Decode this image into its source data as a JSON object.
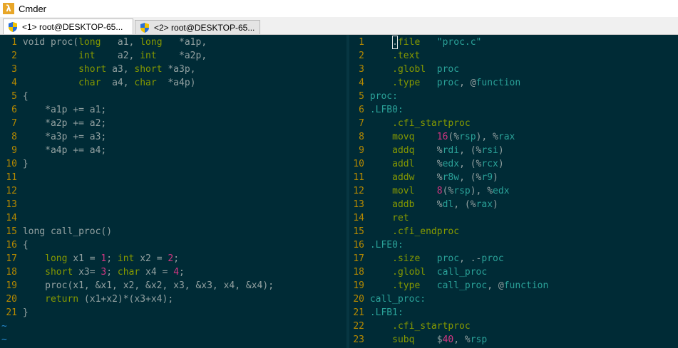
{
  "window": {
    "app_icon_glyph": "λ",
    "title": "Cmder",
    "icon": "cmder-lambda-icon"
  },
  "tabs": [
    {
      "label": "<1> root@DESKTOP-65...",
      "active": true,
      "icon": "uac-shield-icon"
    },
    {
      "label": "<2> root@DESKTOP-65...",
      "active": false,
      "icon": "uac-shield-icon"
    }
  ],
  "left_pane": {
    "lines": [
      {
        "n": "1",
        "tokens": [
          [
            "plain",
            "void proc("
          ],
          [
            "type",
            "long"
          ],
          [
            "plain",
            "   a1, "
          ],
          [
            "type",
            "long"
          ],
          [
            "plain",
            "   *a1p,"
          ]
        ]
      },
      {
        "n": "2",
        "tokens": [
          [
            "plain",
            "          "
          ],
          [
            "type",
            "int"
          ],
          [
            "plain",
            "    a2, "
          ],
          [
            "type",
            "int"
          ],
          [
            "plain",
            "    *a2p,"
          ]
        ]
      },
      {
        "n": "3",
        "tokens": [
          [
            "plain",
            "          "
          ],
          [
            "type",
            "short"
          ],
          [
            "plain",
            " a3, "
          ],
          [
            "type",
            "short"
          ],
          [
            "plain",
            " *a3p,"
          ]
        ]
      },
      {
        "n": "4",
        "tokens": [
          [
            "plain",
            "          "
          ],
          [
            "type",
            "char"
          ],
          [
            "plain",
            "  a4, "
          ],
          [
            "type",
            "char"
          ],
          [
            "plain",
            "  *a4p)"
          ]
        ]
      },
      {
        "n": "5",
        "tokens": [
          [
            "plain",
            "{"
          ]
        ]
      },
      {
        "n": "6",
        "tokens": [
          [
            "plain",
            "    *a1p += a1;"
          ]
        ]
      },
      {
        "n": "7",
        "tokens": [
          [
            "plain",
            "    *a2p += a2;"
          ]
        ]
      },
      {
        "n": "8",
        "tokens": [
          [
            "plain",
            "    *a3p += a3;"
          ]
        ]
      },
      {
        "n": "9",
        "tokens": [
          [
            "plain",
            "    *a4p += a4;"
          ]
        ]
      },
      {
        "n": "10",
        "tokens": [
          [
            "plain",
            "}"
          ]
        ]
      },
      {
        "n": "11",
        "tokens": []
      },
      {
        "n": "12",
        "tokens": []
      },
      {
        "n": "13",
        "tokens": []
      },
      {
        "n": "14",
        "tokens": []
      },
      {
        "n": "15",
        "tokens": [
          [
            "plain",
            "long call_proc()"
          ]
        ]
      },
      {
        "n": "16",
        "tokens": [
          [
            "plain",
            "{"
          ]
        ]
      },
      {
        "n": "17",
        "tokens": [
          [
            "plain",
            "    "
          ],
          [
            "type",
            "long"
          ],
          [
            "plain",
            " x1 = "
          ],
          [
            "num",
            "1"
          ],
          [
            "plain",
            "; "
          ],
          [
            "type",
            "int"
          ],
          [
            "plain",
            " x2 = "
          ],
          [
            "num",
            "2"
          ],
          [
            "plain",
            ";"
          ]
        ]
      },
      {
        "n": "18",
        "tokens": [
          [
            "plain",
            "    "
          ],
          [
            "type",
            "short"
          ],
          [
            "plain",
            " x3= "
          ],
          [
            "num",
            "3"
          ],
          [
            "plain",
            "; "
          ],
          [
            "type",
            "char"
          ],
          [
            "plain",
            " x4 = "
          ],
          [
            "num",
            "4"
          ],
          [
            "plain",
            ";"
          ]
        ]
      },
      {
        "n": "19",
        "tokens": [
          [
            "plain",
            "    proc(x1, &x1, x2, &x2, x3, &x3, x4, &x4);"
          ]
        ]
      },
      {
        "n": "20",
        "tokens": [
          [
            "plain",
            "    "
          ],
          [
            "kw",
            "return"
          ],
          [
            "plain",
            " (x1+x2)*(x3+x4);"
          ]
        ]
      },
      {
        "n": "21",
        "tokens": [
          [
            "plain",
            "}"
          ]
        ]
      }
    ],
    "tilde_lines": [
      "~",
      "~"
    ]
  },
  "right_pane": {
    "lines": [
      {
        "n": "1",
        "tokens": [
          [
            "plain",
            "    "
          ],
          [
            "cursor",
            "."
          ],
          [
            "dir",
            "file"
          ],
          [
            "plain",
            "   "
          ],
          [
            "str",
            "\"proc.c\""
          ]
        ]
      },
      {
        "n": "2",
        "tokens": [
          [
            "plain",
            "    "
          ],
          [
            "dir",
            ".text"
          ]
        ]
      },
      {
        "n": "3",
        "tokens": [
          [
            "plain",
            "    "
          ],
          [
            "dir",
            ".globl"
          ],
          [
            "plain",
            "  "
          ],
          [
            "ident",
            "proc"
          ]
        ]
      },
      {
        "n": "4",
        "tokens": [
          [
            "plain",
            "    "
          ],
          [
            "dir",
            ".type"
          ],
          [
            "plain",
            "   "
          ],
          [
            "ident",
            "proc"
          ],
          [
            "plain",
            ", @"
          ],
          [
            "ident",
            "function"
          ]
        ]
      },
      {
        "n": "5",
        "tokens": [
          [
            "label",
            "proc:"
          ]
        ]
      },
      {
        "n": "6",
        "tokens": [
          [
            "label",
            ".LFB0:"
          ]
        ]
      },
      {
        "n": "7",
        "tokens": [
          [
            "plain",
            "    "
          ],
          [
            "dir",
            ".cfi_startproc"
          ]
        ]
      },
      {
        "n": "8",
        "tokens": [
          [
            "plain",
            "    "
          ],
          [
            "dir",
            "movq"
          ],
          [
            "plain",
            "    "
          ],
          [
            "num",
            "16"
          ],
          [
            "plain",
            "(%"
          ],
          [
            "ident",
            "rsp"
          ],
          [
            "plain",
            "), %"
          ],
          [
            "ident",
            "rax"
          ]
        ]
      },
      {
        "n": "9",
        "tokens": [
          [
            "plain",
            "    "
          ],
          [
            "dir",
            "addq"
          ],
          [
            "plain",
            "    %"
          ],
          [
            "ident",
            "rdi"
          ],
          [
            "plain",
            ", (%"
          ],
          [
            "ident",
            "rsi"
          ],
          [
            "plain",
            ")"
          ]
        ]
      },
      {
        "n": "10",
        "tokens": [
          [
            "plain",
            "    "
          ],
          [
            "dir",
            "addl"
          ],
          [
            "plain",
            "    %"
          ],
          [
            "ident",
            "edx"
          ],
          [
            "plain",
            ", (%"
          ],
          [
            "ident",
            "rcx"
          ],
          [
            "plain",
            ")"
          ]
        ]
      },
      {
        "n": "11",
        "tokens": [
          [
            "plain",
            "    "
          ],
          [
            "dir",
            "addw"
          ],
          [
            "plain",
            "    %"
          ],
          [
            "ident",
            "r8w"
          ],
          [
            "plain",
            ", (%"
          ],
          [
            "ident",
            "r9"
          ],
          [
            "plain",
            ")"
          ]
        ]
      },
      {
        "n": "12",
        "tokens": [
          [
            "plain",
            "    "
          ],
          [
            "dir",
            "movl"
          ],
          [
            "plain",
            "    "
          ],
          [
            "num",
            "8"
          ],
          [
            "plain",
            "(%"
          ],
          [
            "ident",
            "rsp"
          ],
          [
            "plain",
            "), %"
          ],
          [
            "ident",
            "edx"
          ]
        ]
      },
      {
        "n": "13",
        "tokens": [
          [
            "plain",
            "    "
          ],
          [
            "dir",
            "addb"
          ],
          [
            "plain",
            "    %"
          ],
          [
            "ident",
            "dl"
          ],
          [
            "plain",
            ", (%"
          ],
          [
            "ident",
            "rax"
          ],
          [
            "plain",
            ")"
          ]
        ]
      },
      {
        "n": "14",
        "tokens": [
          [
            "plain",
            "    "
          ],
          [
            "dir",
            "ret"
          ]
        ]
      },
      {
        "n": "15",
        "tokens": [
          [
            "plain",
            "    "
          ],
          [
            "dir",
            ".cfi_endproc"
          ]
        ]
      },
      {
        "n": "16",
        "tokens": [
          [
            "label",
            ".LFE0:"
          ]
        ]
      },
      {
        "n": "17",
        "tokens": [
          [
            "plain",
            "    "
          ],
          [
            "dir",
            ".size"
          ],
          [
            "plain",
            "   "
          ],
          [
            "ident",
            "proc"
          ],
          [
            "plain",
            ", .-"
          ],
          [
            "ident",
            "proc"
          ]
        ]
      },
      {
        "n": "18",
        "tokens": [
          [
            "plain",
            "    "
          ],
          [
            "dir",
            ".globl"
          ],
          [
            "plain",
            "  "
          ],
          [
            "ident",
            "call_proc"
          ]
        ]
      },
      {
        "n": "19",
        "tokens": [
          [
            "plain",
            "    "
          ],
          [
            "dir",
            ".type"
          ],
          [
            "plain",
            "   "
          ],
          [
            "ident",
            "call_proc"
          ],
          [
            "plain",
            ", @"
          ],
          [
            "ident",
            "function"
          ]
        ]
      },
      {
        "n": "20",
        "tokens": [
          [
            "label",
            "call_proc:"
          ]
        ]
      },
      {
        "n": "21",
        "tokens": [
          [
            "label",
            ".LFB1:"
          ]
        ]
      },
      {
        "n": "22",
        "tokens": [
          [
            "plain",
            "    "
          ],
          [
            "dir",
            ".cfi_startproc"
          ]
        ]
      },
      {
        "n": "23",
        "tokens": [
          [
            "plain",
            "    "
          ],
          [
            "dir",
            "subq"
          ],
          [
            "plain",
            "    $"
          ],
          [
            "num",
            "40"
          ],
          [
            "plain",
            ", %"
          ],
          [
            "ident",
            "rsp"
          ]
        ]
      }
    ]
  },
  "colors": {
    "background": "#002b36",
    "line_number": "#b58900",
    "text": "#93a1a1",
    "keyword": "#859900",
    "number": "#d33682",
    "identifier": "#2aa198",
    "tilde": "#268bd2"
  }
}
